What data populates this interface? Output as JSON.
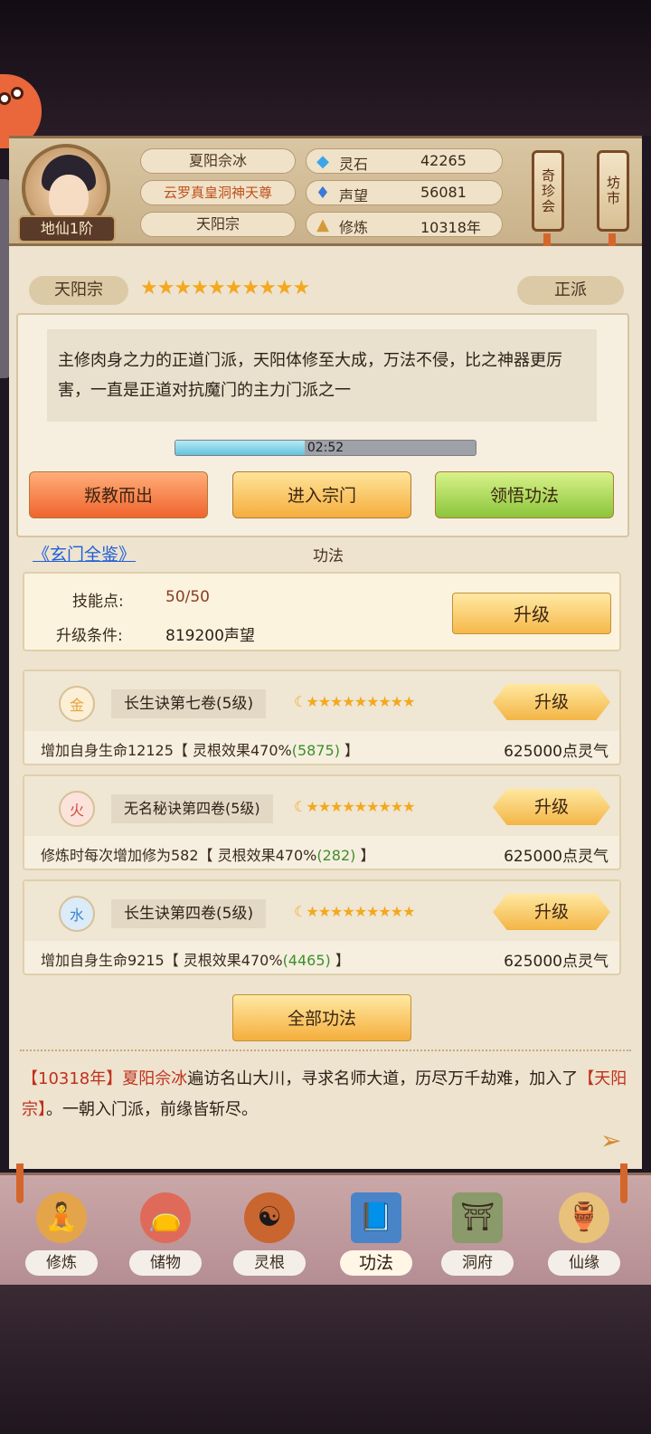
{
  "player": {
    "name": "夏阳佘冰",
    "title": "云罗真皇洞神天尊",
    "sect": "天阳宗",
    "realm": "地仙1阶"
  },
  "stats": [
    {
      "icon": "spirit-stone-icon",
      "label": "灵石",
      "value": "42265"
    },
    {
      "icon": "prestige-icon",
      "label": "声望",
      "value": "56081"
    },
    {
      "icon": "cultivation-icon",
      "label": "修炼",
      "value": "10318年"
    }
  ],
  "shop_buttons": {
    "treasure": "奇珍会",
    "market": "坊市"
  },
  "sect": {
    "name": "天阳宗",
    "stars": "★★★★★★★★★★",
    "faction": "正派",
    "description": "主修肉身之力的正道门派，天阳体修至大成，万法不侵，比之神器更厉害，一直是正道对抗魔门的主力门派之一",
    "timer": "02:52",
    "timer_progress": 0.43,
    "actions": {
      "leave": "叛教而出",
      "enter": "进入宗门",
      "learn": "领悟功法"
    }
  },
  "link": "《玄门全鉴》",
  "section_title": "功法",
  "skill_points": {
    "label": "技能点:",
    "value": "50/50",
    "cond_label": "升级条件:",
    "cond_value": "819200声望",
    "upgrade": "升级"
  },
  "gongfa": [
    {
      "element": "金",
      "element_color": "#e8a23a",
      "name": "长生诀第七卷(5级)",
      "stars": "☾★★★★★★★★★",
      "upgrade": "升级",
      "desc_a": "增加自身生命12125【 灵根效果470%",
      "desc_b": "(5875)",
      "desc_c": " 】",
      "cost": "625000点灵气"
    },
    {
      "element": "火",
      "element_color": "#d34a3a",
      "name": "无名秘诀第四卷(5级)",
      "stars": "☾★★★★★★★★★",
      "upgrade": "升级",
      "desc_a": "修炼时每次增加修为582【 灵根效果470%",
      "desc_b": "(282)",
      "desc_c": " 】",
      "cost": "625000点灵气"
    },
    {
      "element": "水",
      "element_color": "#3a84d3",
      "name": "长生诀第四卷(5级)",
      "stars": "☾★★★★★★★★★",
      "upgrade": "升级",
      "desc_a": "增加自身生命9215【 灵根效果470%",
      "desc_b": "(4465)",
      "desc_c": " 】",
      "cost": "625000点灵气"
    }
  ],
  "all_gongfa": "全部功法",
  "log": {
    "year": "【10318年】",
    "name": "夏阳佘冰",
    "text1": "遍访名山大川，寻求名师大道，历尽万千劫难，加入了",
    "sect": "【天阳宗】",
    "text2": "。一朝入门派，前缘皆斩尽。"
  },
  "nav": [
    {
      "label": "修炼",
      "icon": "cultivate-icon",
      "glyph": "🧘"
    },
    {
      "label": "储物",
      "icon": "storage-bag-icon",
      "glyph": "👝"
    },
    {
      "label": "灵根",
      "icon": "spirit-root-icon",
      "glyph": "☯"
    },
    {
      "label": "功法",
      "icon": "scroll-book-icon",
      "glyph": "📘"
    },
    {
      "label": "洞府",
      "icon": "cave-house-icon",
      "glyph": "⛩"
    },
    {
      "label": "仙缘",
      "icon": "gourd-icon",
      "glyph": "🏺"
    }
  ]
}
